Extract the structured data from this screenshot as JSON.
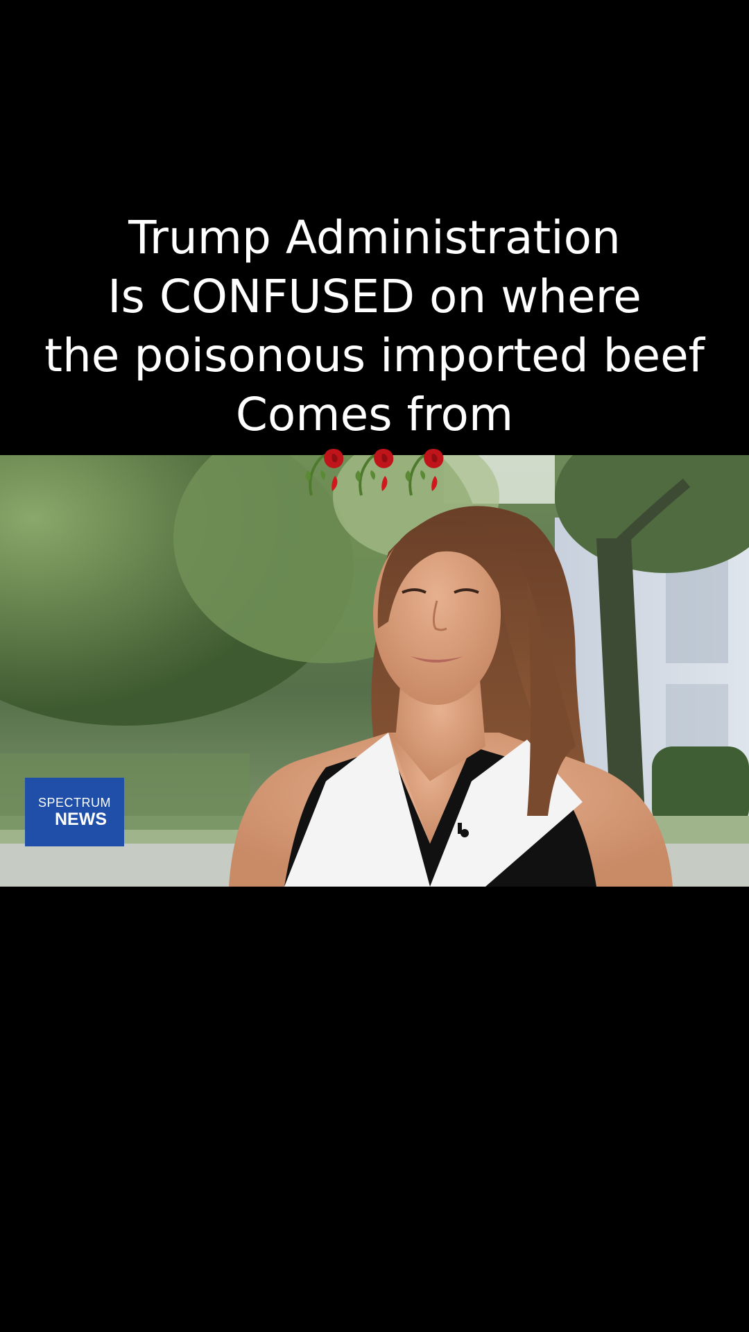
{
  "caption": {
    "lines": [
      "Trump Administration",
      "Is CONFUSED on where",
      "the poisonous imported beef",
      "Comes from"
    ],
    "emoji": [
      "wilted-rose-icon",
      "wilted-rose-icon",
      "wilted-rose-icon"
    ]
  },
  "video": {
    "logo": {
      "line1": "SPECTRUM",
      "line2": "NEWS"
    },
    "colors": {
      "logo_blue": "#1f4fa8",
      "background": "#000000",
      "caption_text": "#ffffff"
    }
  }
}
